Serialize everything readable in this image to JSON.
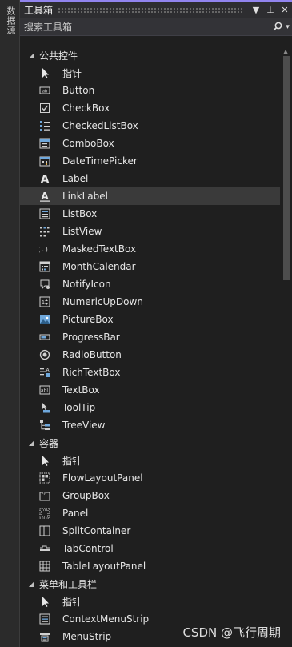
{
  "sidetab": {
    "label": "数据源"
  },
  "toolbox": {
    "title": "工具箱",
    "dropdown_glyph": "▼",
    "pin_glyph": "⊥",
    "close_glyph": "✕",
    "search_placeholder": "搜索工具箱",
    "search_dropdown_glyph": "▾"
  },
  "categories": [
    {
      "name": "公共控件",
      "items": [
        {
          "label": "指针",
          "icon": "pointer-icon"
        },
        {
          "label": "Button",
          "icon": "button-icon"
        },
        {
          "label": "CheckBox",
          "icon": "checkbox-icon"
        },
        {
          "label": "CheckedListBox",
          "icon": "checkedlistbox-icon"
        },
        {
          "label": "ComboBox",
          "icon": "combobox-icon"
        },
        {
          "label": "DateTimePicker",
          "icon": "datetimepicker-icon"
        },
        {
          "label": "Label",
          "icon": "label-icon"
        },
        {
          "label": "LinkLabel",
          "icon": "linklabel-icon",
          "selected": true
        },
        {
          "label": "ListBox",
          "icon": "listbox-icon"
        },
        {
          "label": "ListView",
          "icon": "listview-icon"
        },
        {
          "label": "MaskedTextBox",
          "icon": "maskedtextbox-icon"
        },
        {
          "label": "MonthCalendar",
          "icon": "monthcalendar-icon"
        },
        {
          "label": "NotifyIcon",
          "icon": "notifyicon-icon"
        },
        {
          "label": "NumericUpDown",
          "icon": "numericupdown-icon"
        },
        {
          "label": "PictureBox",
          "icon": "picturebox-icon"
        },
        {
          "label": "ProgressBar",
          "icon": "progressbar-icon"
        },
        {
          "label": "RadioButton",
          "icon": "radiobutton-icon"
        },
        {
          "label": "RichTextBox",
          "icon": "richtextbox-icon"
        },
        {
          "label": "TextBox",
          "icon": "textbox-icon"
        },
        {
          "label": "ToolTip",
          "icon": "tooltip-icon"
        },
        {
          "label": "TreeView",
          "icon": "treeview-icon"
        }
      ]
    },
    {
      "name": "容器",
      "items": [
        {
          "label": "指针",
          "icon": "pointer-icon"
        },
        {
          "label": "FlowLayoutPanel",
          "icon": "flowlayoutpanel-icon"
        },
        {
          "label": "GroupBox",
          "icon": "groupbox-icon"
        },
        {
          "label": "Panel",
          "icon": "panel-icon"
        },
        {
          "label": "SplitContainer",
          "icon": "splitcontainer-icon"
        },
        {
          "label": "TabControl",
          "icon": "tabcontrol-icon"
        },
        {
          "label": "TableLayoutPanel",
          "icon": "tablelayoutpanel-icon"
        }
      ]
    },
    {
      "name": "菜单和工具栏",
      "items": [
        {
          "label": "指针",
          "icon": "pointer-icon"
        },
        {
          "label": "ContextMenuStrip",
          "icon": "contextmenustrip-icon"
        },
        {
          "label": "MenuStrip",
          "icon": "menustrip-icon"
        }
      ]
    }
  ],
  "watermark": "CSDN @飞行周期"
}
